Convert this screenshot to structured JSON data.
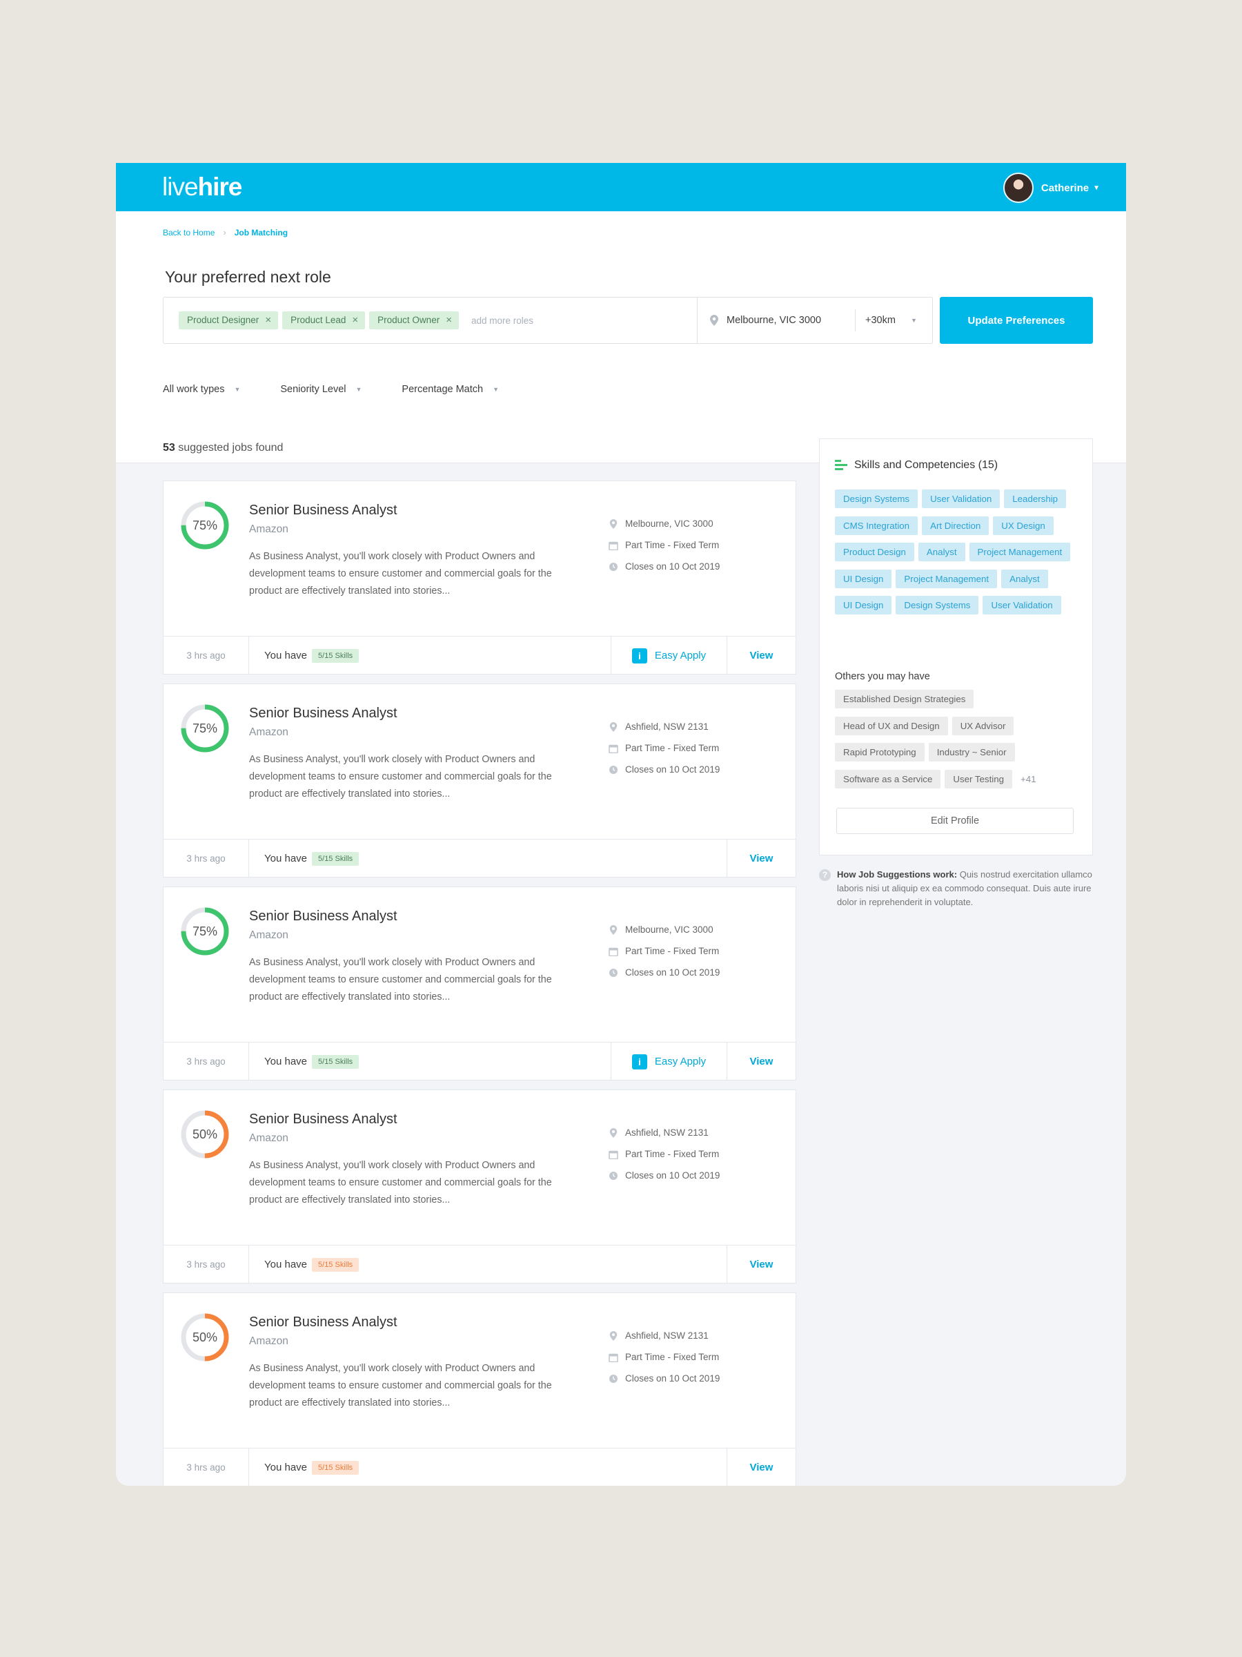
{
  "header": {
    "logo_light": "live",
    "logo_bold": "hire",
    "user_name": "Catherine"
  },
  "breadcrumb": {
    "back": "Back to Home",
    "current": "Job Matching"
  },
  "preferences": {
    "title": "Your preferred next role",
    "roles": [
      "Product Designer",
      "Product Lead",
      "Product Owner"
    ],
    "add_placeholder": "add more roles",
    "location": "Melbourne, VIC 3000",
    "radius": "+30km",
    "update_label": "Update Preferences"
  },
  "filters": [
    "All work types",
    "Seniority Level",
    "Percentage Match"
  ],
  "results": {
    "count": "53",
    "label": "suggested jobs found"
  },
  "jobs": [
    {
      "match": 75,
      "match_label": "75%",
      "title": "Senior Business Analyst",
      "company": "Amazon",
      "description": "As Business Analyst, you'll work closely with Product Owners and development teams to ensure customer and commercial goals for the product are effectively translated into stories...",
      "location": "Melbourne, VIC 3000",
      "type": "Part Time - Fixed Term",
      "closes": "Closes on 10 Oct 2019",
      "ago": "3 hrs ago",
      "you_have": "You have",
      "skills": "5/15 Skills",
      "easy_apply": "Easy Apply",
      "view": "View"
    },
    {
      "match": 75,
      "match_label": "75%",
      "title": "Senior Business Analyst",
      "company": "Amazon",
      "description": "As Business Analyst, you'll work closely with Product Owners and development teams to ensure customer and commercial goals for the product are effectively translated into stories...",
      "location": "Ashfield, NSW 2131",
      "type": "Part Time - Fixed Term",
      "closes": "Closes on 10 Oct 2019",
      "ago": "3 hrs ago",
      "you_have": "You have",
      "skills": "5/15 Skills",
      "view": "View"
    },
    {
      "match": 75,
      "match_label": "75%",
      "title": "Senior Business Analyst",
      "company": "Amazon",
      "description": "As Business Analyst, you'll work closely with Product Owners and development teams to ensure customer and commercial goals for the product are effectively translated into stories...",
      "location": "Melbourne, VIC 3000",
      "type": "Part Time - Fixed Term",
      "closes": "Closes on 10 Oct 2019",
      "ago": "3 hrs ago",
      "you_have": "You have",
      "skills": "5/15 Skills",
      "easy_apply": "Easy Apply",
      "view": "View"
    },
    {
      "match": 50,
      "match_label": "50%",
      "title": "Senior Business Analyst",
      "company": "Amazon",
      "description": "As Business Analyst, you'll work closely with Product Owners and development teams to ensure customer and commercial goals for the product are effectively translated into stories...",
      "location": "Ashfield, NSW 2131",
      "type": "Part Time - Fixed Term",
      "closes": "Closes on 10 Oct 2019",
      "ago": "3 hrs ago",
      "you_have": "You have",
      "skills": "5/15 Skills",
      "view": "View"
    },
    {
      "match": 50,
      "match_label": "50%",
      "title": "Senior Business Analyst",
      "company": "Amazon",
      "description": "As Business Analyst, you'll work closely with Product Owners and development teams to ensure customer and commercial goals for the product are effectively translated into stories...",
      "location": "Ashfield, NSW 2131",
      "type": "Part Time - Fixed Term",
      "closes": "Closes on 10 Oct 2019",
      "ago": "3 hrs ago",
      "you_have": "You have",
      "skills": "5/15 Skills",
      "view": "View"
    }
  ],
  "sidebar": {
    "title": "Skills and Competencies (15)",
    "skills": [
      "Design Systems",
      "User Validation",
      "Leadership",
      "CMS Integration",
      "Art Direction",
      "UX Design",
      "Product Design",
      "Analyst",
      "Project Management",
      "UI Design",
      "Project Management",
      "Analyst",
      "UI Design",
      "Design Systems",
      "User Validation"
    ],
    "others_title": "Others you may have",
    "others": [
      "Established Design Strategies",
      "Head of UX and Design",
      "UX Advisor",
      "Rapid Prototyping",
      "Industry ~ Senior",
      "Software as a Service",
      "User Testing"
    ],
    "others_more": "+41",
    "edit_label": "Edit Profile"
  },
  "how": {
    "label": "How Job Suggestions work:",
    "text": "Quis nostrud exercitation ullamco laboris nisi ut aliquip ex ea commodo consequat. Duis aute irure dolor in reprehenderit in voluptate."
  },
  "colors": {
    "brand": "#00b8e8",
    "match_high": "#3ec46d",
    "match_mid": "#f5833c",
    "ring_track": "#e3e5e8"
  },
  "icons": {
    "location": "map-pin-icon",
    "type": "calendar-icon",
    "closes": "clock-icon",
    "easy_apply": "easy-apply-icon"
  }
}
